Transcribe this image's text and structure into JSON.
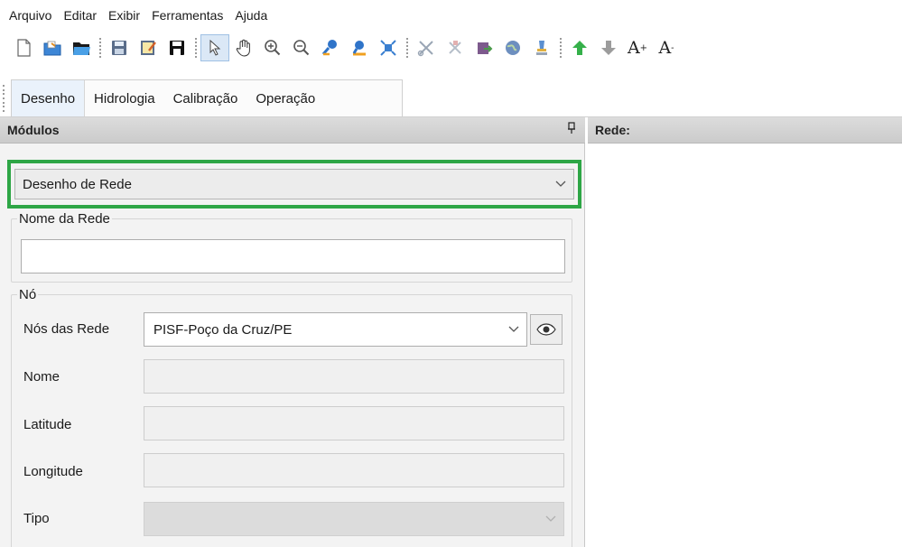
{
  "menubar": {
    "items": [
      "Arquivo",
      "Editar",
      "Exibir",
      "Ferramentas",
      "Ajuda"
    ]
  },
  "toolbar": {
    "groups": [
      [
        "new-file-icon",
        "open-folder-icon",
        "open-file-icon"
      ],
      [
        "save-disk-icon",
        "edit-note-icon",
        "save-as-icon"
      ],
      [
        "select-arrow-icon",
        "pan-hand-icon",
        "zoom-in-icon",
        "zoom-out-icon",
        "draw-node-icon",
        "draw-link-icon",
        "fit-extent-icon"
      ],
      [
        "cut-tool-icon",
        "delete-tool-icon",
        "export-icon",
        "globe-icon",
        "properties-icon"
      ],
      [
        "arrow-up-icon",
        "arrow-down-icon",
        "font-increase-icon",
        "font-decrease-icon"
      ]
    ],
    "font_increase_text": "A",
    "font_increase_sup": "+",
    "font_decrease_text": "A",
    "font_decrease_sup": "-"
  },
  "tabs": {
    "items": [
      "Desenho",
      "Hidrologia",
      "Calibração",
      "Operação"
    ],
    "active": "Desenho"
  },
  "modules": {
    "title": "Módulos",
    "pin_glyph": "ᵽ",
    "selected_module": "Desenho de Rede",
    "nome_rede": {
      "legend": "Nome da Rede",
      "value": ""
    },
    "no": {
      "legend": "Nó",
      "nos_label": "Nós das Rede",
      "nos_value": "PISF-Poço da Cruz/PE",
      "nome_label": "Nome",
      "nome_value": "",
      "latitude_label": "Latitude",
      "latitude_value": "",
      "longitude_label": "Longitude",
      "longitude_value": "",
      "tipo_label": "Tipo",
      "tipo_value": ""
    }
  },
  "rede": {
    "title": "Rede:"
  },
  "colors": {
    "highlight": "#2ea646",
    "panel_bg": "#f3f3f3",
    "header_bg": "#d3d3d3",
    "tab_active_bg": "#eaf2fb"
  }
}
